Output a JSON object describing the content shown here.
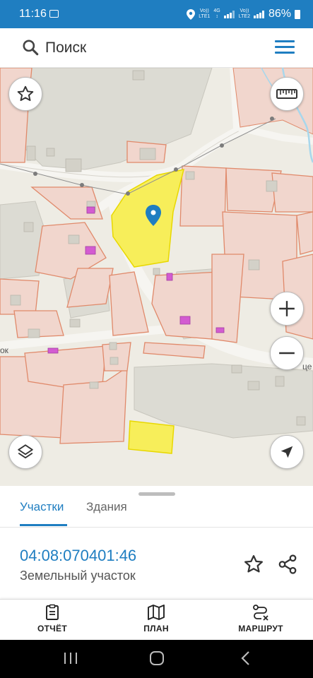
{
  "status_bar": {
    "time": "11:16",
    "net1_top": "Vo))",
    "net1_bottom": "LTE1",
    "net_mid": "4G",
    "net2_top": "Vo))",
    "net2_bottom": "LTE2",
    "battery": "86%"
  },
  "search": {
    "placeholder": "Поиск",
    "icon": "search-icon",
    "menu_icon": "hamburger-menu-icon"
  },
  "map": {
    "street_label_left": "ок",
    "street_label_right": "це",
    "selected_color": "#f7ee5a",
    "parcel_stroke": "#e0896a",
    "parcel_fill": "#f1d6cd",
    "controls": [
      "favorite-star-icon",
      "ruler-icon",
      "zoom-in-icon",
      "zoom-out-icon",
      "layers-icon",
      "location-arrow-icon"
    ]
  },
  "sheet": {
    "tabs": [
      {
        "label": "Участки",
        "active": true
      },
      {
        "label": "Здания",
        "active": false
      }
    ],
    "parcel_number": "04:08:070401:46",
    "parcel_type": "Земельный участок"
  },
  "bottom_nav": {
    "items": [
      {
        "label": "ОТЧЁТ",
        "icon": "report-icon"
      },
      {
        "label": "ПЛАН",
        "icon": "map-plan-icon"
      },
      {
        "label": "МАРШРУТ",
        "icon": "route-icon"
      }
    ]
  },
  "colors": {
    "accent": "#1f7ec1",
    "map_background": "#eeece4"
  }
}
